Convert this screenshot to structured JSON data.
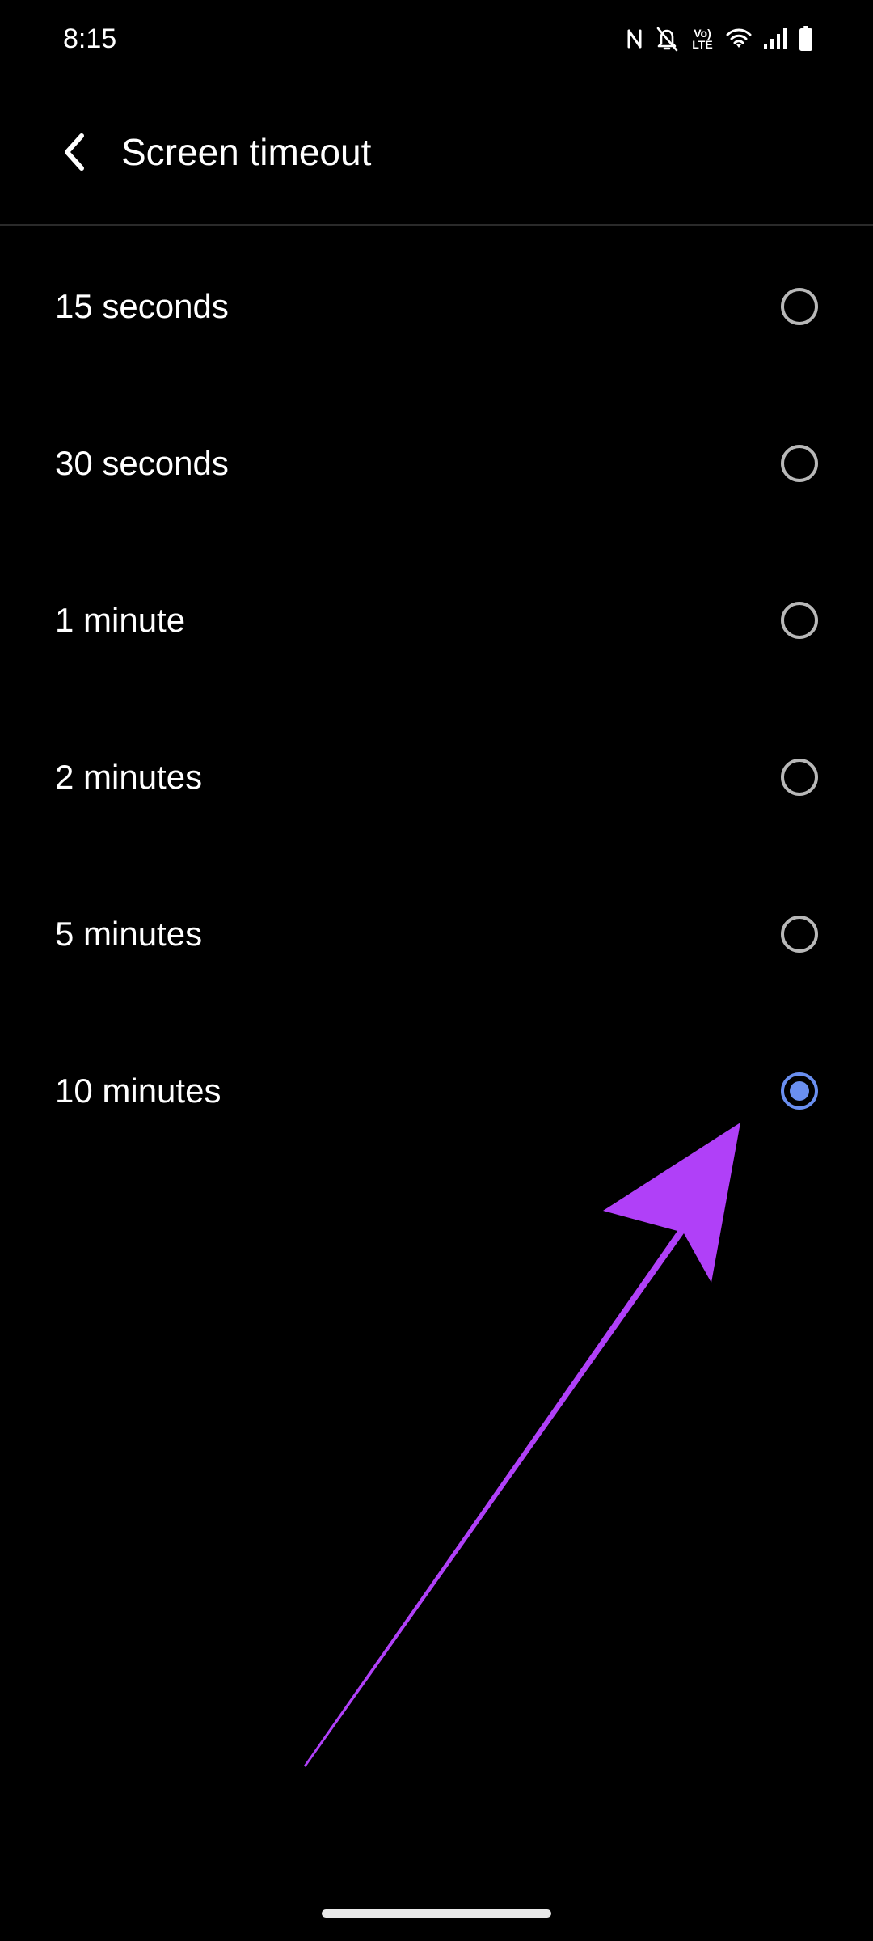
{
  "status_bar": {
    "time": "8:15",
    "icons": [
      "nfc-icon",
      "bell-off-icon",
      "volte-icon",
      "wifi-icon",
      "signal-icon",
      "battery-icon"
    ],
    "volte_line1": "Vo)",
    "volte_line2": "LTE"
  },
  "app_bar": {
    "back_icon": "chevron-left-icon",
    "title": "Screen timeout"
  },
  "options": [
    {
      "label": "15 seconds",
      "selected": false
    },
    {
      "label": "30 seconds",
      "selected": false
    },
    {
      "label": "1 minute",
      "selected": false
    },
    {
      "label": "2 minutes",
      "selected": false
    },
    {
      "label": "5 minutes",
      "selected": false
    },
    {
      "label": "10 minutes",
      "selected": true
    }
  ],
  "colors": {
    "background": "#000000",
    "text": "#ffffff",
    "radio_unchecked": "#b8b8b8",
    "radio_checked": "#6a8ff0",
    "annotation_arrow": "#b040f8"
  }
}
